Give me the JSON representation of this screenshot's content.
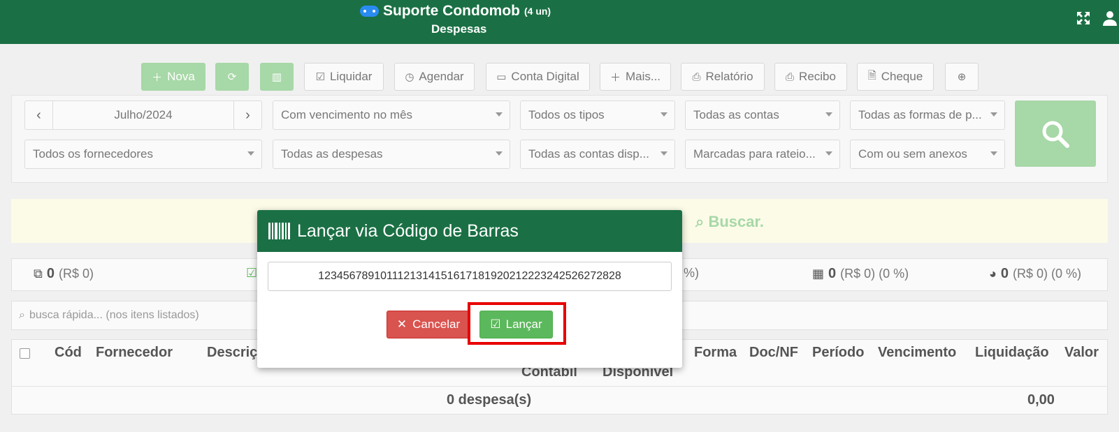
{
  "header": {
    "title": "Suporte Condomob",
    "count": "(4 un)",
    "subtitle": "Despesas",
    "icons": [
      "expand-icon",
      "user-icon"
    ]
  },
  "toolbar": {
    "nova": "Nova",
    "liquidar": "Liquidar",
    "agendar": "Agendar",
    "conta_digital": "Conta Digital",
    "mais": "Mais...",
    "relatorio": "Relatório",
    "recibo": "Recibo",
    "cheque": "Cheque"
  },
  "filters": {
    "month": "Julho/2024",
    "vencimento": "Com vencimento no mês",
    "tipos": "Todos os tipos",
    "contas": "Todas as contas",
    "formas": "Todas as formas de p...",
    "fornecedores": "Todos os fornecedores",
    "despesas": "Todas as despesas",
    "contas_disp": "Todas as contas disp...",
    "rateio": "Marcadas para rateio...",
    "anexos": "Com ou sem anexos"
  },
  "alert": {
    "text": "Buscar."
  },
  "stats": [
    {
      "count": "0",
      "detail": "(R$ 0)"
    },
    {
      "count": "",
      "detail": "%)"
    },
    {
      "count": "0",
      "detail": "(R$ 0) (0 %)"
    },
    {
      "count": "0",
      "detail": "(R$ 0) (0 %)"
    }
  ],
  "quick_search": {
    "placeholder": "busca rápida... (nos itens listados)"
  },
  "table": {
    "headers": [
      "Cód",
      "Fornecedor",
      "Descriç",
      "Forma",
      "Doc/NF",
      "Período",
      "Vencimento",
      "Liquidação",
      "Valor"
    ],
    "headers_row2": [
      "Contábil",
      "Disponível"
    ],
    "total_label": "0 despesa(s)",
    "total_value": "0,00"
  },
  "modal": {
    "title": "Lançar via Código de Barras",
    "barcode_value": "1234567891011121314151617181920212223242526272828",
    "cancel": "Cancelar",
    "launch": "Lançar"
  },
  "colors": {
    "primary_green": "#1a7044",
    "light_green": "#a7d8a7",
    "danger": "#d9534f",
    "success": "#5cb85c",
    "highlight": "#e80000"
  }
}
